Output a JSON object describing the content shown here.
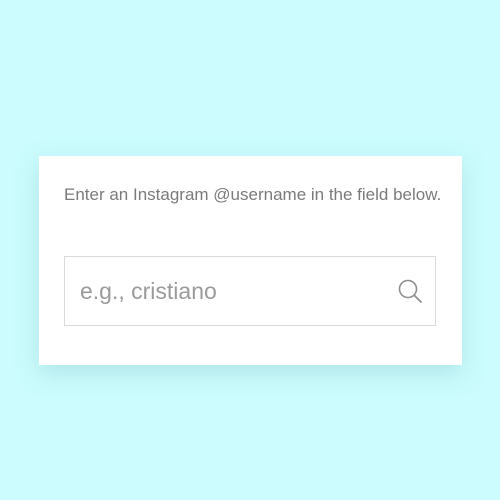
{
  "form": {
    "instructions": "Enter an Instagram @username in the field below.",
    "search": {
      "value": "",
      "placeholder": "e.g., cristiano",
      "icon": "search-icon"
    }
  },
  "colors": {
    "background": "#ccfcfd",
    "card": "#ffffff",
    "text": "#7b7b7b",
    "placeholder": "#9a9a9a",
    "border": "#dadada"
  }
}
